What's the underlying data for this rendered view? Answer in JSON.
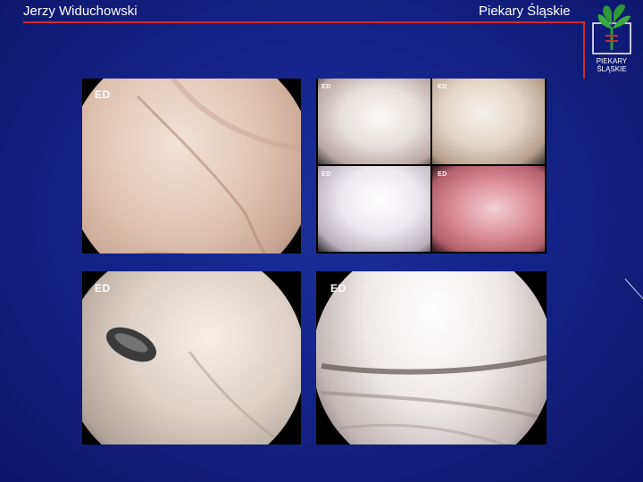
{
  "header": {
    "author": "Jerzy Widuchowski",
    "place": "Piekary Śląskie"
  },
  "logo": {
    "line1": "PIEKARY",
    "line2": "ŚLĄSKIE",
    "icon": "clover-leaf-icon"
  },
  "panels": {
    "top_left": {
      "label": "ED"
    },
    "top_right": {
      "labels": [
        "ED",
        "ED",
        "ED",
        "ED"
      ]
    },
    "bottom_left": {
      "label": "ED"
    },
    "bottom_right": {
      "label": "ED"
    }
  },
  "colors": {
    "background": "#14238a",
    "accent_line": "#d42a2a",
    "logo_green": "#2f9a3a"
  }
}
